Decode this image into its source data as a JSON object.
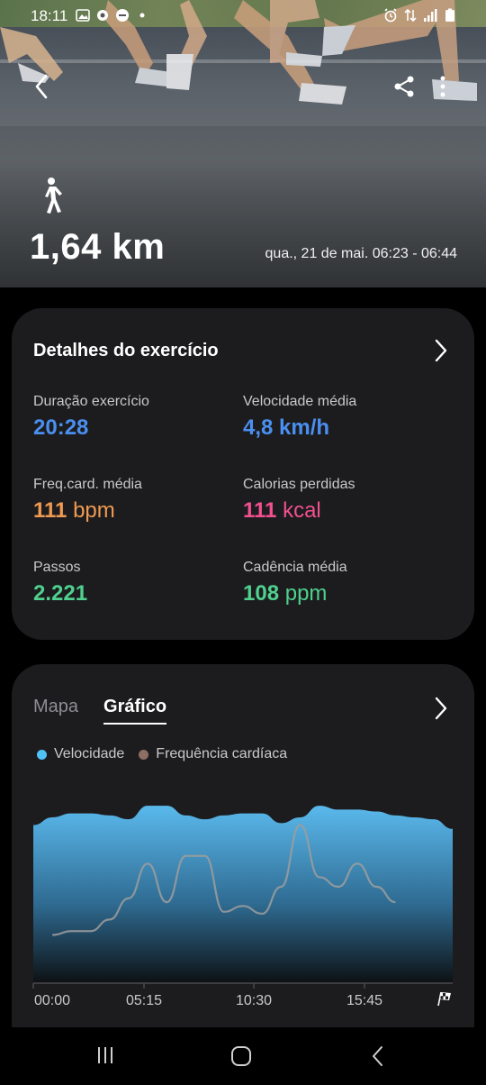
{
  "status_bar": {
    "time": "18:11"
  },
  "hero": {
    "distance": "1,64 km",
    "datetime": "qua., 21 de mai. 06:23 - 06:44",
    "icons": {
      "back": "back-arrow-icon",
      "share": "share-icon",
      "more": "more-vertical-icon",
      "activity": "walking-icon"
    }
  },
  "details": {
    "title": "Detalhes do exercício",
    "metrics": [
      {
        "label": "Duração exercício",
        "value": "20:28",
        "unit": "",
        "color": "#4a8ff0"
      },
      {
        "label": "Velocidade média",
        "value": "4,8",
        "unit": "km/h",
        "color": "#4a8ff0"
      },
      {
        "label": "Freq.card. média",
        "value": "111",
        "unit": "bpm",
        "color": "#ef9a52"
      },
      {
        "label": "Calorias perdidas",
        "value": "111",
        "unit": "kcal",
        "color": "#f2508f"
      },
      {
        "label": "Passos",
        "value": "2.221",
        "unit": "",
        "color": "#4fd08e"
      },
      {
        "label": "Cadência média",
        "value": "108",
        "unit": "ppm",
        "color": "#4fd08e"
      }
    ]
  },
  "graph_card": {
    "tabs": [
      {
        "label": "Mapa",
        "selected": false
      },
      {
        "label": "Gráfico",
        "selected": true
      }
    ],
    "legend": [
      {
        "label": "Velocidade",
        "color": "#4fc3f7"
      },
      {
        "label": "Frequência cardíaca",
        "color": "#8d6e63"
      }
    ]
  },
  "chart_data": {
    "type": "area",
    "x_ticks": [
      "00:00",
      "05:15",
      "10:30",
      "15:45"
    ],
    "end_marker": "finish-flag-icon",
    "series": [
      {
        "name": "Velocidade",
        "values": [
          0.82,
          0.86,
          0.88,
          0.88,
          0.87,
          0.85,
          0.92,
          0.92,
          0.87,
          0.85,
          0.87,
          0.88,
          0.88,
          0.83,
          0.86,
          0.92,
          0.9,
          0.9,
          0.89,
          0.87,
          0.86,
          0.85,
          0.8
        ],
        "color": "#4fc3f7"
      },
      {
        "name": "Frequência cardíaca",
        "values": [
          null,
          0.25,
          0.27,
          0.27,
          0.33,
          0.44,
          0.62,
          0.42,
          0.66,
          0.66,
          0.37,
          0.4,
          0.36,
          0.5,
          0.82,
          0.55,
          0.5,
          0.62,
          0.5,
          0.42,
          null,
          null,
          null
        ],
        "color": "#9e9e9e"
      }
    ]
  },
  "nav": {
    "recents": "recents-icon",
    "home": "home-icon",
    "back": "back-icon"
  }
}
